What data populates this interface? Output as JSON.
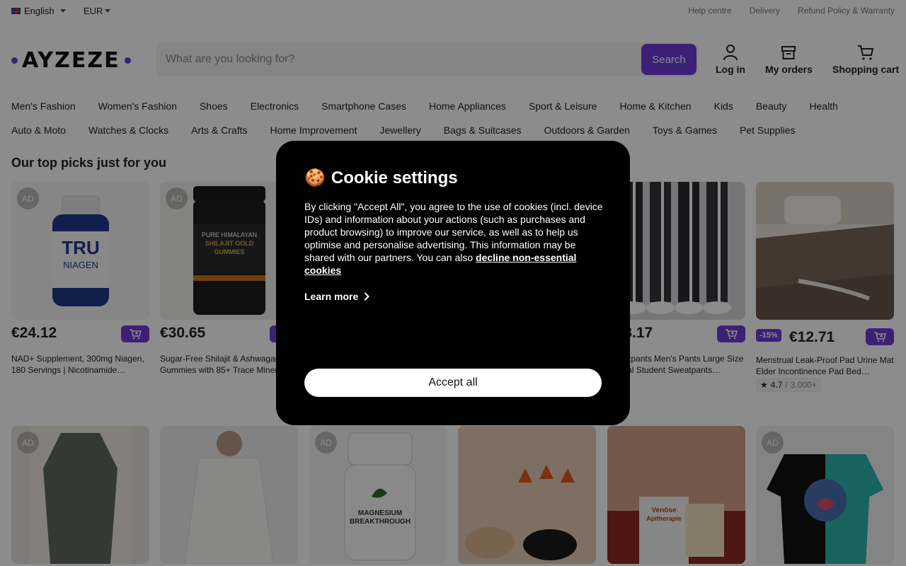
{
  "topbar": {
    "language": "English",
    "currency": "EUR",
    "links": [
      "Help centre",
      "Delivery",
      "Refund Policy & Warranty"
    ]
  },
  "header": {
    "logo": "AYZEZE",
    "search_placeholder": "What are you looking for?",
    "search_button": "Search",
    "login": "Log in",
    "orders": "My orders",
    "cart": "Shopping cart"
  },
  "categories_row1": [
    "Men's Fashion",
    "Women's Fashion",
    "Shoes",
    "Electronics",
    "Smartphone Cases",
    "Home Appliances",
    "Sport & Leisure",
    "Home & Kitchen",
    "Kids",
    "Beauty",
    "Health"
  ],
  "categories_row2": [
    "Auto & Moto",
    "Watches & Clocks",
    "Arts & Crafts",
    "Home Improvement",
    "Jewellery",
    "Bags & Suitcases",
    "Outdoors & Garden",
    "Toys & Games",
    "Pet Supplies"
  ],
  "section_title": "Our top picks just for you",
  "products": [
    {
      "ad": "AD",
      "price": "€24.12",
      "title": "NAD+ Supplement, 300mg Niagen, 180 Servings | Nicotinamide…",
      "image": "supplement-bottle"
    },
    {
      "ad": "AD",
      "price": "€30.65",
      "title": "Sugar-Free Shilajit & Ashwagandha Gummies with 85+ Trace Minerals…",
      "image": "gummies-jar"
    },
    {
      "ad": "",
      "price": "",
      "title": "",
      "image": ""
    },
    {
      "ad": "",
      "price": "",
      "title": "",
      "image": ""
    },
    {
      "ad": "",
      "price": "€13.17",
      "title": "Sweatpants Men's Pants Large Size Casual Student Sweatpants…",
      "image": "sweatpants"
    },
    {
      "ad": "",
      "badge": "-15%",
      "price": "€12.71",
      "title": "Menstrual Leak-Proof Pad Urine Mat Elder Incontinence Pad Bed…",
      "rating": "4.7",
      "rating_count": "3.000+",
      "image": "bed-pad"
    }
  ],
  "row2_ads": [
    "AD",
    "",
    "AD",
    "",
    "",
    "AD"
  ],
  "cookie": {
    "title": "Cookie settings",
    "body": "By clicking \"Accept All\", you agree to the use of cookies (incl. device IDs) and information about your actions (such as purchases and product browsing) to improve our service, as well as to help us optimise and personalise advertising. This information may be shared with our partners. You can also ",
    "decline_link": "decline non-essential cookies",
    "learn_more": "Learn more",
    "accept": "Accept all"
  },
  "colors": {
    "accent": "#6c3bd8",
    "overlay": "rgba(0,0,0,0.45)"
  }
}
